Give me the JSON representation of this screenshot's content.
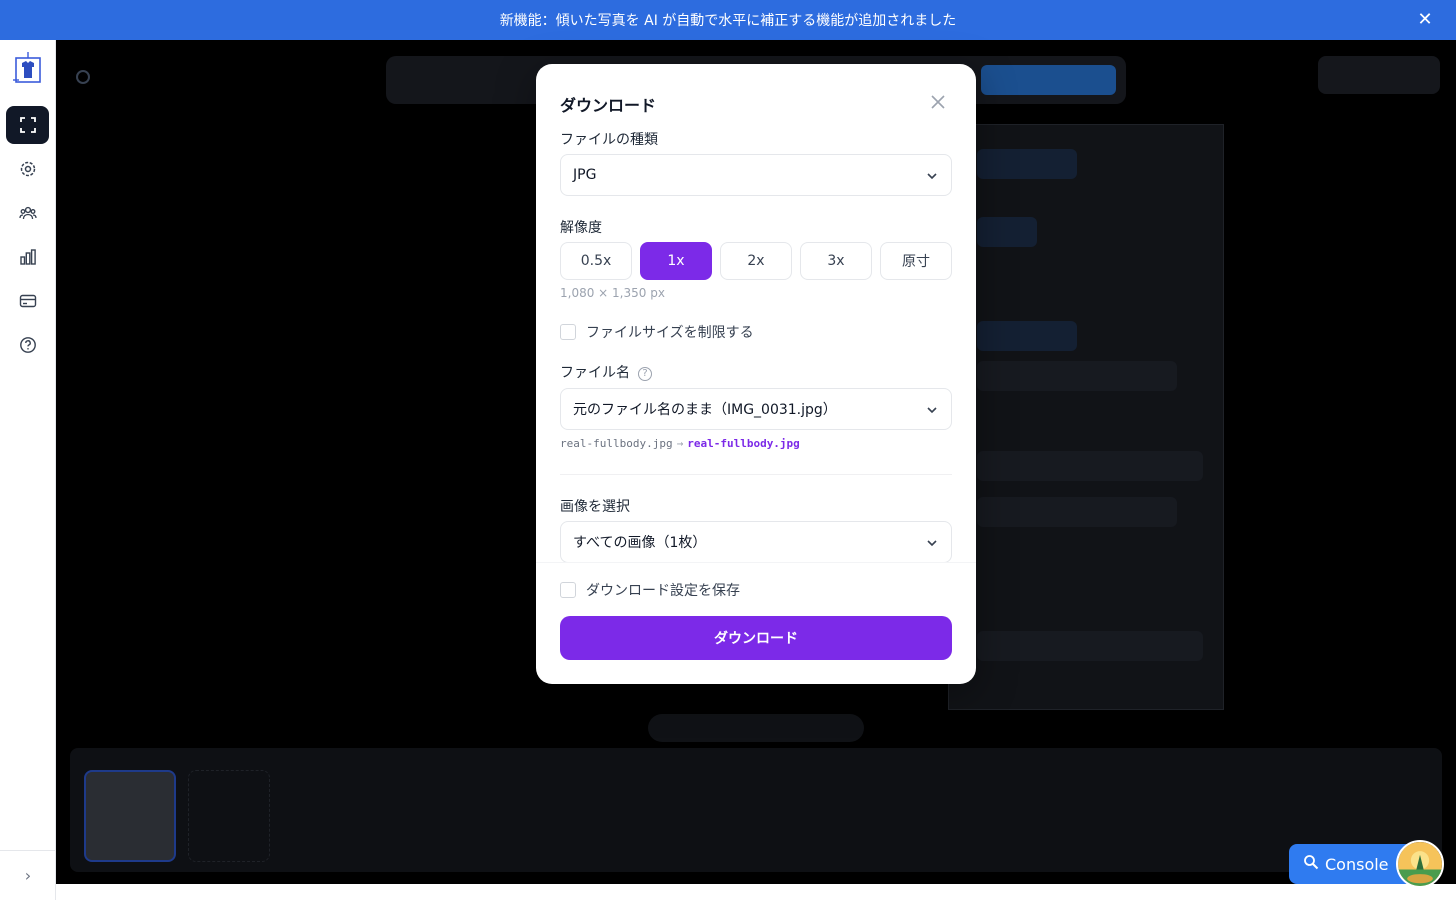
{
  "banner": {
    "text": "新機能：傾いた写真を AI が自動で水平に補正する機能が追加されました"
  },
  "sidebar": {
    "items": [
      {
        "icon": "crop-frame-icon",
        "active": true
      },
      {
        "icon": "gear-icon",
        "active": false
      },
      {
        "icon": "users-icon",
        "active": false
      },
      {
        "icon": "bar-chart-icon",
        "active": false
      },
      {
        "icon": "credit-card-icon",
        "active": false
      },
      {
        "icon": "help-circle-icon",
        "active": false
      }
    ]
  },
  "modal": {
    "title": "ダウンロード",
    "file_type": {
      "label": "ファイルの種類",
      "value": "JPG"
    },
    "resolution": {
      "label": "解像度",
      "options": [
        "0.5x",
        "1x",
        "2x",
        "3x",
        "原寸"
      ],
      "selected": "1x",
      "dimensions": "1,080 × 1,350 px"
    },
    "limit_size": {
      "label": "ファイルサイズを制限する",
      "checked": false
    },
    "file_name": {
      "label": "ファイル名",
      "value": "元のファイル名のまま（IMG_0031.jpg）",
      "preview_from": "real-fullbody.jpg",
      "preview_arrow": "→",
      "preview_to": "real-fullbody.jpg"
    },
    "image_select": {
      "label": "画像を選択",
      "value": "すべての画像（1枚）"
    },
    "save_settings": {
      "label": "ダウンロード設定を保存",
      "checked": false
    },
    "download_button": "ダウンロード"
  },
  "console": {
    "label": "Console"
  },
  "colors": {
    "accent": "#7c2ae8",
    "banner": "#2d6cdf",
    "console": "#2f7bf0"
  }
}
